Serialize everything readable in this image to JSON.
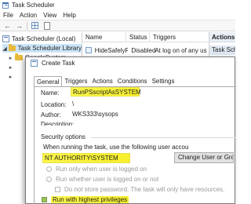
{
  "window": {
    "title": "Task Scheduler",
    "menu": [
      "File",
      "Action",
      "View",
      "Help"
    ]
  },
  "tree": {
    "items": [
      "Task Scheduler (Local)",
      "Task Scheduler Library",
      "GoogleSystem"
    ]
  },
  "task_list": {
    "columns": [
      "Name",
      "Status",
      "Triggers"
    ],
    "rows": [
      {
        "name": "HideSafelyR...",
        "status": "Disabled",
        "triggers": "At log on of any us"
      }
    ]
  },
  "actions_pane": {
    "header": "Actions",
    "item": "Task Sche"
  },
  "dialog": {
    "title": "Create Task",
    "tabs": [
      "General",
      "Triggers",
      "Actions",
      "Conditions",
      "Settings"
    ],
    "active_tab": "General",
    "fields": {
      "name_label": "Name:",
      "name_value": "RunPSscriptAsSYSTEM",
      "location_label": "Location:",
      "location_value": "\\",
      "author_label": "Author:",
      "author_value": "WKS333\\sysops",
      "description_label": "Description:"
    },
    "security": {
      "title": "Security options",
      "run_text": "When running the task, use the following user accou",
      "account": "NT AUTHORITY\\SYSTEM",
      "change_button": "Change User or Group...",
      "radio_logged_on": "Run only when user is logged on",
      "radio_whether": "Run whether user is logged on or not",
      "do_not_store": "Do not store password.  The task will only have resources.",
      "highest_privileges": "Run with highest privileges",
      "highest_privileges_checked": true
    },
    "highlight_color": "#f7ef2c"
  }
}
